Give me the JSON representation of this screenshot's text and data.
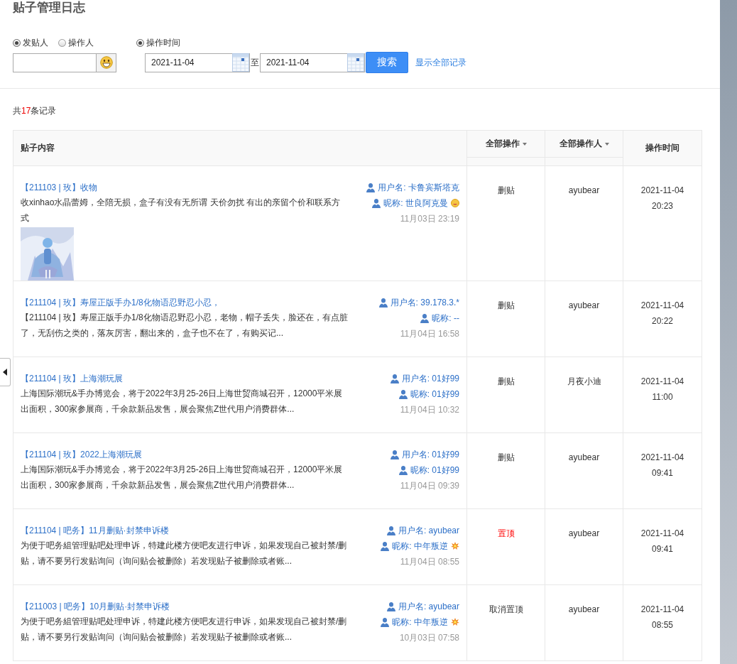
{
  "title": "贴子管理日志",
  "filters": {
    "user_radios": [
      {
        "label": "发贴人",
        "selected": true
      },
      {
        "label": "操作人",
        "selected": false
      }
    ],
    "time_radio": {
      "label": "操作时间",
      "selected": true
    },
    "date_from": "2021-11-04",
    "date_sep": "至",
    "date_to": "2021-11-04",
    "search_button": "搜索",
    "show_all_link": "显示全部记录"
  },
  "summary": {
    "prefix": "共",
    "count": "17",
    "suffix": "条记录"
  },
  "table": {
    "columns": [
      {
        "label": "贴子内容",
        "dropdown": false
      },
      {
        "label": "全部操作",
        "dropdown": true
      },
      {
        "label": "全部操作人",
        "dropdown": true
      },
      {
        "label": "操作时间",
        "dropdown": false
      }
    ],
    "rows": [
      {
        "title": "【211103 | 玫】收物",
        "body": "收xinhao水晶蕾姆，全陪无损，盒子有没有无所谓 天价勿扰 有出的亲留个价和联系方式",
        "username": "用户名: 卡鲁宾斯塔克",
        "nickname": "昵称: 世良阿克曼",
        "nickname_badge": {
          "kind": "face"
        },
        "post_time": "11月03日 23:19",
        "action": "删贴",
        "action_highlighted": false,
        "operator": "ayubear",
        "op_date": "2021-11-04",
        "op_time": "20:23"
      },
      {
        "title": "【211104 | 玫】寿屋正版手办1/8化物语忍野忍小忍，",
        "body": "【211104 | 玫】寿屋正版手办1/8化物语忍野忍小忍，老物，帽子丢失，脸还在，有点脏了，无刮伤之类的，落灰厉害，翻出来的，盒子也不在了，有购买记...",
        "username": "用户名: 39.178.3.*",
        "nickname": "昵称: --",
        "post_time": "11月04日 16:58",
        "action": "删贴",
        "action_highlighted": false,
        "operator": "ayubear",
        "op_date": "2021-11-04",
        "op_time": "20:22"
      },
      {
        "title": "【211104 | 玫】上海潮玩展",
        "body": "上海国际潮玩&手办博览会，将于2022年3月25-26日上海世贸商城召开，12000平米展出面积，300家参展商，千余款新品发售，展会聚焦Z世代用户消费群体...",
        "username": "用户名: 01好99",
        "nickname": "昵称: 01好99",
        "post_time": "11月04日 10:32",
        "action": "删贴",
        "action_highlighted": false,
        "operator": "月夜小迪",
        "op_date": "2021-11-04",
        "op_time": "11:00"
      },
      {
        "title": "【211104 | 玫】2022上海潮玩展",
        "body": "上海国际潮玩&手办博览会，将于2022年3月25-26日上海世贸商城召开，12000平米展出面积，300家参展商，千余款新品发售，展会聚焦Z世代用户消费群体...",
        "username": "用户名: 01好99",
        "nickname": "昵称: 01好99",
        "post_time": "11月04日 09:39",
        "action": "删贴",
        "action_highlighted": false,
        "operator": "ayubear",
        "op_date": "2021-11-04",
        "op_time": "09:41"
      },
      {
        "title": "【211104 | 吧务】11月删贴·封禁申诉楼",
        "body": "为便于吧务組管理贴吧处理申诉，特建此楼方便吧友进行申诉，如果发现自己被封禁/删贴，请不要另行发贴询问（询问贴会被删除）若发现贴子被删除或者账...",
        "username": "用户名: ayubear",
        "nickname": "昵称: 中年叛逆",
        "nickname_badge": {
          "kind": "burst"
        },
        "post_time": "11月04日 08:55",
        "action": "置顶",
        "action_highlighted": true,
        "operator": "ayubear",
        "op_date": "2021-11-04",
        "op_time": "09:41"
      },
      {
        "title": "【211003 | 吧务】10月删贴·封禁申诉楼",
        "body": "为便于吧务組管理贴吧处理申诉，特建此楼方便吧友进行申诉，如果发现自己被封禁/删贴，请不要另行发贴询问（询问贴会被删除）若发现贴子被删除或者账...",
        "username": "用户名: ayubear",
        "nickname": "昵称: 中年叛逆",
        "nickname_badge": {
          "kind": "burst"
        },
        "post_time": "10月03日 07:58",
        "action": "取消置顶",
        "action_highlighted": false,
        "operator": "ayubear",
        "op_date": "2021-11-04",
        "op_time": "08:55"
      }
    ]
  }
}
